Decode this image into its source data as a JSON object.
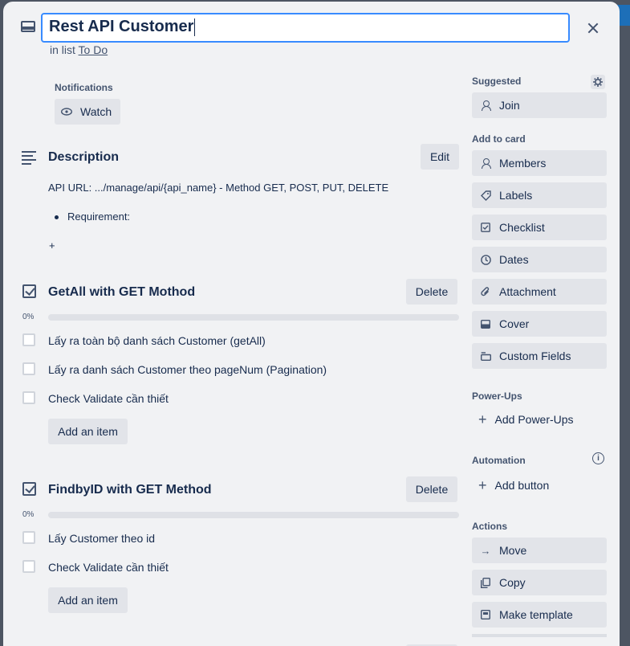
{
  "card": {
    "title": "Rest API Customer",
    "in_list_prefix": "in list",
    "list_name": "To Do"
  },
  "notifications": {
    "label": "Notifications",
    "watch_label": "Watch"
  },
  "description": {
    "title": "Description",
    "edit_label": "Edit",
    "line1": "API URL: .../manage/api/{api_name} - Method GET, POST, PUT, DELETE",
    "bullet1": "Requirement:",
    "plus": "+"
  },
  "checklists": [
    {
      "title": "GetAll with GET Mothod",
      "delete_label": "Delete",
      "progress": "0%",
      "progress_value": 0,
      "items": [
        "Lấy ra toàn bộ danh sách Customer (getAll)",
        "Lấy ra danh sách Customer theo pageNum (Pagination)",
        "Check Validate cần thiết"
      ],
      "add_item_label": "Add an item"
    },
    {
      "title": "FindbyID with GET Method",
      "delete_label": "Delete",
      "progress": "0%",
      "progress_value": 0,
      "items": [
        "Lấy Customer theo id",
        "Check Validate cần thiết"
      ],
      "add_item_label": "Add an item"
    }
  ],
  "sidebar": {
    "suggested_label": "Suggested",
    "join_label": "Join",
    "add_to_card_label": "Add to card",
    "add_to_card": [
      "Members",
      "Labels",
      "Checklist",
      "Dates",
      "Attachment",
      "Cover",
      "Custom Fields"
    ],
    "powerups_label": "Power-Ups",
    "add_powerups_label": "Add Power-Ups",
    "automation_label": "Automation",
    "add_button_label": "Add button",
    "actions_label": "Actions",
    "actions": [
      "Move",
      "Copy",
      "Make template"
    ]
  },
  "colors": {
    "accent": "#388bff",
    "modal_bg": "#f1f2f4",
    "button_bg": "#e2e4e9",
    "text": "#172b4d"
  }
}
